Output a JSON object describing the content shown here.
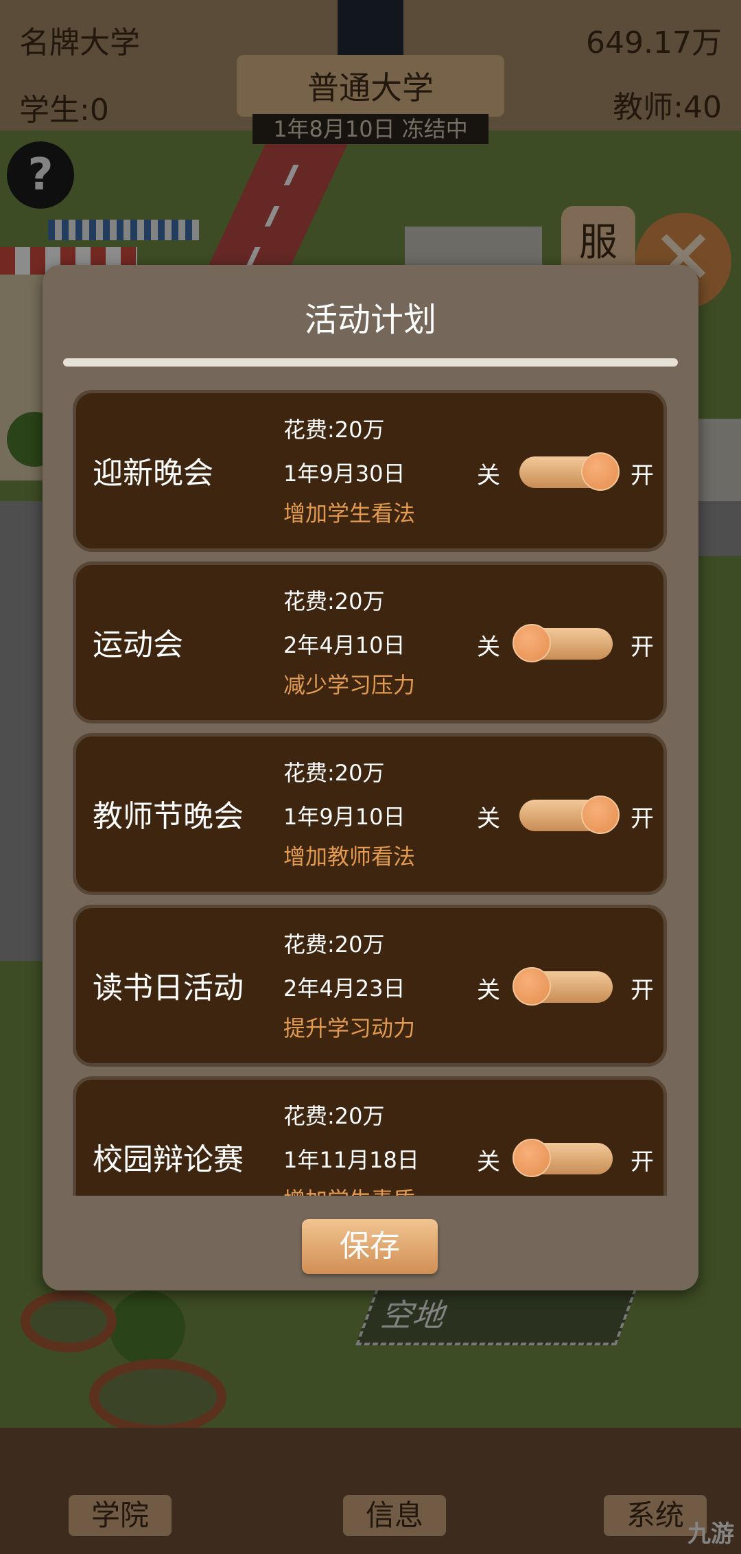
{
  "hud": {
    "university_name": "名牌大学",
    "money": "649.17万",
    "students": "学生:0",
    "teachers": "教师:40",
    "level": "普通大学",
    "date_status": "1年8月10日 冻结中",
    "help_icon": "question-mark-icon",
    "side_button": "服",
    "close_icon": "close-x-icon"
  },
  "scene": {
    "plot_label": "空地"
  },
  "bottom_nav": {
    "tabs": [
      "学院",
      "信息",
      "系统"
    ]
  },
  "watermark": "九游",
  "modal": {
    "title": "活动计划",
    "off_label": "关",
    "on_label": "开",
    "save_label": "保存",
    "activities": [
      {
        "name": "迎新晚会",
        "cost": "花费:20万",
        "date": "1年9月30日",
        "effect": "增加学生看法",
        "enabled": true
      },
      {
        "name": "运动会",
        "cost": "花费:20万",
        "date": "2年4月10日",
        "effect": "减少学习压力",
        "enabled": false
      },
      {
        "name": "教师节晚会",
        "cost": "花费:20万",
        "date": "1年9月10日",
        "effect": "增加教师看法",
        "enabled": true
      },
      {
        "name": "读书日活动",
        "cost": "花费:20万",
        "date": "2年4月23日",
        "effect": "提升学习动力",
        "enabled": false
      },
      {
        "name": "校园辩论赛",
        "cost": "花费:20万",
        "date": "1年11月18日",
        "effect": "增加学生素质",
        "enabled": false
      }
    ]
  },
  "colors": {
    "card_bg": "#3d250f",
    "modal_bg": "#75685a",
    "effect_text": "#e39a52",
    "button": "#e3a96e"
  }
}
